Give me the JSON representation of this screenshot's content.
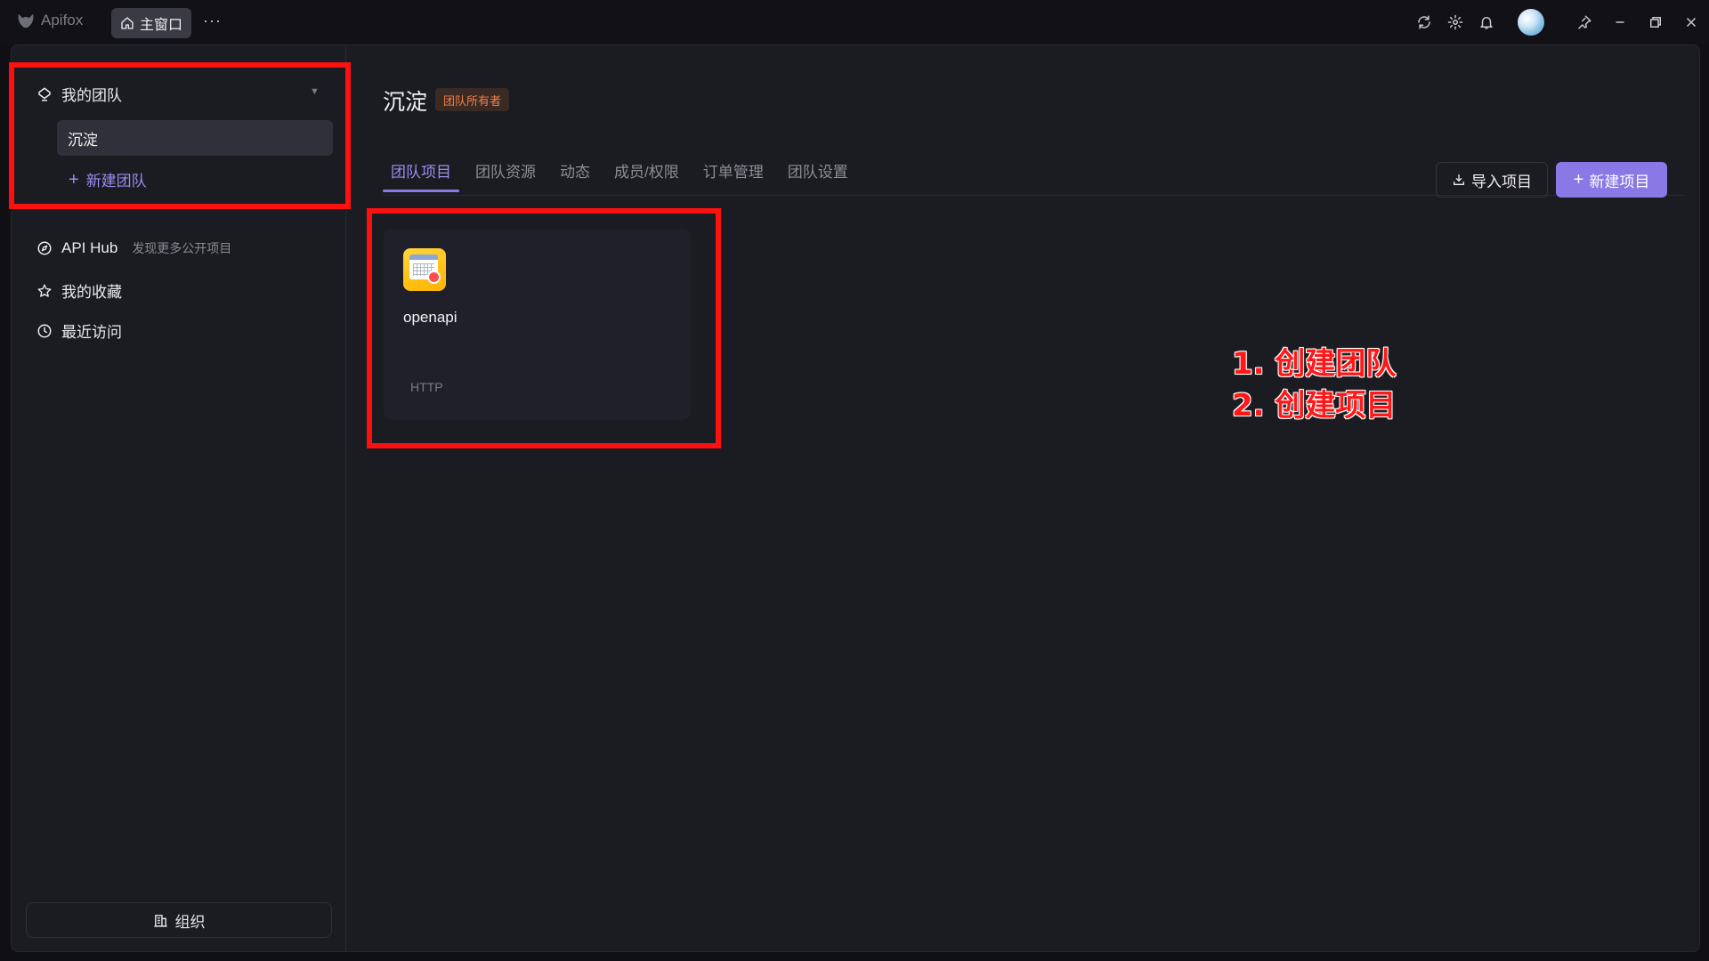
{
  "titlebar": {
    "app_name": "Apifox",
    "home_tab": "主窗口",
    "more": "···"
  },
  "sidebar": {
    "team_section_title": "我的团队",
    "teams": [
      "沉淀"
    ],
    "new_team": "新建团队",
    "nav": [
      {
        "label": "API Hub",
        "hint": "发现更多公开项目",
        "icon": "compass-icon"
      },
      {
        "label": "我的收藏",
        "icon": "star-icon"
      },
      {
        "label": "最近访问",
        "icon": "clock-icon"
      }
    ],
    "org_button": "组织"
  },
  "main": {
    "team_name": "沉淀",
    "role_badge": "团队所有者",
    "tabs": [
      "团队项目",
      "团队资源",
      "动态",
      "成员/权限",
      "订单管理",
      "团队设置"
    ],
    "active_tab": 0,
    "import_button": "导入项目",
    "new_project_button": "新建项目",
    "projects": [
      {
        "name": "openapi",
        "type": "HTTP",
        "icon": "calendar-clock-icon"
      }
    ]
  },
  "annotations": {
    "step1": "1. 创建团队",
    "step2": "2. 创建项目",
    "color": "#ff1818"
  },
  "colors": {
    "accent": "#8a78e6",
    "role_badge": "#f07f4c",
    "highlight_box": "#ff1010"
  }
}
